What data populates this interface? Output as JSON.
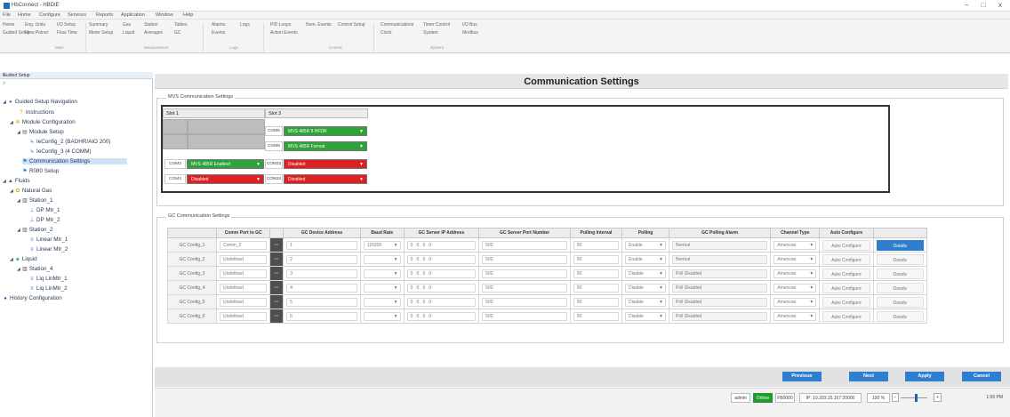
{
  "window": {
    "title": "HbConnect - HBDIE",
    "minimize": "–",
    "maximize": "□",
    "close": "x"
  },
  "menu": [
    "File",
    "Home",
    "Configure",
    "Services",
    "Reports",
    "Application",
    "Window",
    "Help"
  ],
  "ribbon": {
    "groups": [
      "Main",
      "Measurement",
      "Logs",
      "Control",
      "System"
    ],
    "buttons": [
      "Home",
      "Guided Setup",
      "Eng. Units",
      "Flow Polner",
      "I/O Setup",
      "Flow Time",
      "Summary",
      "Meter Setup",
      "Gas",
      "Liquid",
      "Station",
      "Averages",
      "Tables",
      "GC",
      "Alarms",
      "Events",
      "Logs",
      "PID Loops",
      "Action Events",
      "Nom. Events",
      "Control Setup",
      "Communications",
      "Clock",
      "Timer Control",
      "System",
      "I/O Bus",
      "Modbus"
    ]
  },
  "sidebar": {
    "title": "Guided Setup",
    "items": [
      {
        "label": "Guided Setup Navigation"
      },
      {
        "label": "Instructions"
      },
      {
        "label": "Module Configuration"
      },
      {
        "label": "Module Setup"
      },
      {
        "label": "IeConfig_2 (BADHR/AIO 200)"
      },
      {
        "label": "IeConfig_3 (4 COMM)"
      },
      {
        "label": "Communication Settings"
      },
      {
        "label": "R080 Setup"
      },
      {
        "label": "Fluids"
      },
      {
        "label": "Natural Gas"
      },
      {
        "label": "Station_1"
      },
      {
        "label": "DP Mtr_1"
      },
      {
        "label": "DP Mtr_2"
      },
      {
        "label": "Station_2"
      },
      {
        "label": "Linear Mtr_1"
      },
      {
        "label": "Linear Mtr_2"
      },
      {
        "label": "Liquid"
      },
      {
        "label": "Station_4"
      },
      {
        "label": "Liq LinMtr_1"
      },
      {
        "label": "Liq LinMtr_2"
      },
      {
        "label": "History Configuration"
      }
    ]
  },
  "page_title": "Communication Settings",
  "mvs": {
    "legend": "MVS Communication Settings",
    "slot1": "Slot 1",
    "slot3": "Slot 3",
    "com": {
      "c5": "COM5",
      "c6": "COM6",
      "c3": "COM3",
      "c4": "COM4",
      "c33": "COM33",
      "c34": "COM34"
    },
    "values": {
      "com5": "MVS 485R 8 HFDR",
      "com6": "MVS 485R Format",
      "com3": "MVS 485R Enabled",
      "com33": "Disabled",
      "com4": "Disabled",
      "com34": "Disabled"
    }
  },
  "gc": {
    "legend": "GC Communication Settings",
    "headers": [
      "",
      "Comm Port to GC",
      "",
      "GC Device Address",
      "Baud Rate",
      "GC Server IP Address",
      "GC Server Port Number",
      "Polling Interval",
      "Polling",
      "GC Polling Alarm",
      "Channel Type",
      "Auto Configure",
      ""
    ],
    "rows": [
      {
        "name": "GC Config_1",
        "port": "Comm_2",
        "addr": "1",
        "baud": "115200",
        "ip": "0 . 0 . 0 . 0",
        "portnum": "502",
        "interval": "60",
        "polling": "Enable",
        "alarm": "Normal",
        "channel": "American",
        "auto": "Auto Configure",
        "details": "Details"
      },
      {
        "name": "GC Config_2",
        "port": "Undefined",
        "addr": "2",
        "baud": "",
        "ip": "0 . 0 . 0 . 0",
        "portnum": "502",
        "interval": "60",
        "polling": "Enable",
        "alarm": "Normal",
        "channel": "American",
        "auto": "Auto Configure",
        "details": "Details"
      },
      {
        "name": "GC Config_3",
        "port": "Undefined",
        "addr": "3",
        "baud": "",
        "ip": "0 . 0 . 0 . 0",
        "portnum": "502",
        "interval": "60",
        "polling": "Disable",
        "alarm": "Poll Disabled",
        "channel": "American",
        "auto": "Auto Configure",
        "details": "Details"
      },
      {
        "name": "GC Config_4",
        "port": "Undefined",
        "addr": "4",
        "baud": "",
        "ip": "0 . 0 . 0 . 0",
        "portnum": "502",
        "interval": "60",
        "polling": "Disable",
        "alarm": "Poll Disabled",
        "channel": "American",
        "auto": "Auto Configure",
        "details": "Details"
      },
      {
        "name": "GC Config_5",
        "port": "Undefined",
        "addr": "5",
        "baud": "",
        "ip": "0 . 0 . 0 . 0",
        "portnum": "502",
        "interval": "60",
        "polling": "Disable",
        "alarm": "Poll Disabled",
        "channel": "American",
        "auto": "Auto Configure",
        "details": "Details"
      },
      {
        "name": "GC Config_6",
        "port": "Undefined",
        "addr": "6",
        "baud": "",
        "ip": "0 . 0 . 0 . 0",
        "portnum": "502",
        "interval": "60",
        "polling": "Disable",
        "alarm": "Poll Disabled",
        "channel": "American",
        "auto": "Auto Configure",
        "details": "Details"
      }
    ]
  },
  "actions": {
    "previous": "Previous",
    "next": "Next",
    "apply": "Apply",
    "cancel": "Cancel"
  },
  "status": {
    "user": "admin",
    "online": "Online",
    "device": "FB0000",
    "ip": "IP: 10.203.15.167:20000",
    "zoom": "100 %",
    "time": "1:55 PM"
  },
  "colors": {
    "accent": "#2f7fd0",
    "ok": "#2ea33a",
    "error": "#dd2020"
  }
}
